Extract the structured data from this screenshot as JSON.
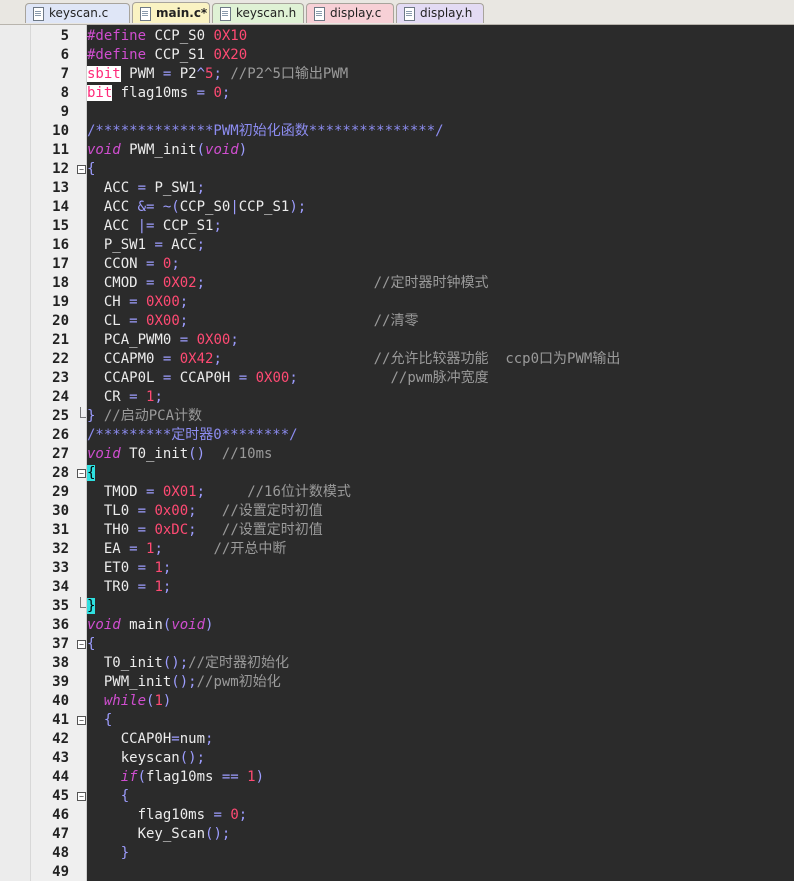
{
  "tabs": [
    {
      "label": "keyscan.c",
      "bg": "#dfe6f7",
      "width": 105,
      "active": false
    },
    {
      "label": "main.c*",
      "bg": "#faf3c3",
      "width": 78,
      "active": true
    },
    {
      "label": "keyscan.h",
      "bg": "#dff2d5",
      "width": 92,
      "active": false
    },
    {
      "label": "display.c",
      "bg": "#f7d0d6",
      "width": 88,
      "active": false
    },
    {
      "label": "display.h",
      "bg": "#e3dbf4",
      "width": 88,
      "active": false
    }
  ],
  "lines": [
    {
      "n": 5,
      "fold": "",
      "code": [
        [
          "pp",
          "#define"
        ],
        [
          "t",
          " CCP_S0 "
        ],
        [
          "num",
          "0X10"
        ]
      ]
    },
    {
      "n": 6,
      "fold": "",
      "code": [
        [
          "pp",
          "#define"
        ],
        [
          "t",
          " CCP_S1 "
        ],
        [
          "num",
          "0X20"
        ]
      ]
    },
    {
      "n": 7,
      "fold": "",
      "code": [
        [
          "hl",
          "sbit"
        ],
        [
          "t",
          " PWM "
        ],
        [
          "op",
          "="
        ],
        [
          "t",
          " P2"
        ],
        [
          "op",
          "^"
        ],
        [
          "num",
          "5"
        ],
        [
          "op",
          ";"
        ],
        [
          "cm",
          " //P2^5口输出PWM"
        ]
      ]
    },
    {
      "n": 8,
      "fold": "",
      "code": [
        [
          "hl",
          "bit"
        ],
        [
          "t",
          " flag10ms "
        ],
        [
          "op",
          "="
        ],
        [
          "t",
          " "
        ],
        [
          "num",
          "0"
        ],
        [
          "op",
          ";"
        ]
      ]
    },
    {
      "n": 9,
      "fold": "",
      "code": []
    },
    {
      "n": 10,
      "fold": "",
      "code": [
        [
          "cmb",
          "/**************PWM初始化函数***************/"
        ]
      ]
    },
    {
      "n": 11,
      "fold": "",
      "code": [
        [
          "kw",
          "void"
        ],
        [
          "t",
          " PWM_init"
        ],
        [
          "op",
          "("
        ],
        [
          "kw",
          "void"
        ],
        [
          "op",
          ")"
        ]
      ]
    },
    {
      "n": 12,
      "fold": "-",
      "code": [
        [
          "op",
          "{"
        ]
      ]
    },
    {
      "n": 13,
      "fold": "",
      "code": [
        [
          "t",
          "  ACC "
        ],
        [
          "op",
          "="
        ],
        [
          "t",
          " P_SW1"
        ],
        [
          "op",
          ";"
        ]
      ]
    },
    {
      "n": 14,
      "fold": "",
      "code": [
        [
          "t",
          "  ACC "
        ],
        [
          "op",
          "&= ~("
        ],
        [
          "t",
          "CCP_S0"
        ],
        [
          "op",
          "|"
        ],
        [
          "t",
          "CCP_S1"
        ],
        [
          "op",
          ");"
        ]
      ]
    },
    {
      "n": 15,
      "fold": "",
      "code": [
        [
          "t",
          "  ACC "
        ],
        [
          "op",
          "|="
        ],
        [
          "t",
          " CCP_S1"
        ],
        [
          "op",
          ";"
        ]
      ]
    },
    {
      "n": 16,
      "fold": "",
      "code": [
        [
          "t",
          "  P_SW1 "
        ],
        [
          "op",
          "="
        ],
        [
          "t",
          " ACC"
        ],
        [
          "op",
          ";"
        ]
      ]
    },
    {
      "n": 17,
      "fold": "",
      "code": [
        [
          "t",
          "  CCON "
        ],
        [
          "op",
          "="
        ],
        [
          "t",
          " "
        ],
        [
          "num",
          "0"
        ],
        [
          "op",
          ";"
        ]
      ]
    },
    {
      "n": 18,
      "fold": "",
      "code": [
        [
          "t",
          "  CMOD "
        ],
        [
          "op",
          "="
        ],
        [
          "t",
          " "
        ],
        [
          "num",
          "0X02"
        ],
        [
          "op",
          ";"
        ],
        [
          "t",
          "                    "
        ],
        [
          "cm",
          "//定时器时钟模式"
        ]
      ]
    },
    {
      "n": 19,
      "fold": "",
      "code": [
        [
          "t",
          "  CH "
        ],
        [
          "op",
          "="
        ],
        [
          "t",
          " "
        ],
        [
          "num",
          "0X00"
        ],
        [
          "op",
          ";"
        ]
      ]
    },
    {
      "n": 20,
      "fold": "",
      "code": [
        [
          "t",
          "  CL "
        ],
        [
          "op",
          "="
        ],
        [
          "t",
          " "
        ],
        [
          "num",
          "0X00"
        ],
        [
          "op",
          ";"
        ],
        [
          "t",
          "                      "
        ],
        [
          "cm",
          "//清零"
        ]
      ]
    },
    {
      "n": 21,
      "fold": "",
      "code": [
        [
          "t",
          "  PCA_PWM0 "
        ],
        [
          "op",
          "="
        ],
        [
          "t",
          " "
        ],
        [
          "num",
          "0X00"
        ],
        [
          "op",
          ";"
        ]
      ]
    },
    {
      "n": 22,
      "fold": "",
      "code": [
        [
          "t",
          "  CCAPM0 "
        ],
        [
          "op",
          "="
        ],
        [
          "t",
          " "
        ],
        [
          "num",
          "0X42"
        ],
        [
          "op",
          ";"
        ],
        [
          "t",
          "                  "
        ],
        [
          "cm",
          "//允许比较器功能  ccp0口为PWM输出"
        ]
      ]
    },
    {
      "n": 23,
      "fold": "",
      "code": [
        [
          "t",
          "  CCAP0L "
        ],
        [
          "op",
          "="
        ],
        [
          "t",
          " CCAP0H "
        ],
        [
          "op",
          "="
        ],
        [
          "t",
          " "
        ],
        [
          "num",
          "0X00"
        ],
        [
          "op",
          ";"
        ],
        [
          "t",
          "           "
        ],
        [
          "cm",
          "//pwm脉冲宽度"
        ]
      ]
    },
    {
      "n": 24,
      "fold": "",
      "code": [
        [
          "t",
          "  CR "
        ],
        [
          "op",
          "="
        ],
        [
          "t",
          " "
        ],
        [
          "num",
          "1"
        ],
        [
          "op",
          ";"
        ]
      ]
    },
    {
      "n": 25,
      "fold": "end",
      "code": [
        [
          "op",
          "}"
        ],
        [
          "cm",
          " //启动PCA计数"
        ]
      ]
    },
    {
      "n": 26,
      "fold": "",
      "code": [
        [
          "cmb",
          "/*********定时器0********/"
        ]
      ]
    },
    {
      "n": 27,
      "fold": "",
      "code": [
        [
          "kw",
          "void"
        ],
        [
          "t",
          " T0_init"
        ],
        [
          "op",
          "()"
        ],
        [
          "cm",
          "  //10ms"
        ]
      ]
    },
    {
      "n": 28,
      "fold": "-",
      "code": [
        [
          "br",
          "{"
        ]
      ]
    },
    {
      "n": 29,
      "fold": "",
      "code": [
        [
          "t",
          "  TMOD "
        ],
        [
          "op",
          "="
        ],
        [
          "t",
          " "
        ],
        [
          "num",
          "0X01"
        ],
        [
          "op",
          ";"
        ],
        [
          "t",
          "     "
        ],
        [
          "cm",
          "//16位计数模式"
        ]
      ]
    },
    {
      "n": 30,
      "fold": "",
      "code": [
        [
          "t",
          "  TL0 "
        ],
        [
          "op",
          "="
        ],
        [
          "t",
          " "
        ],
        [
          "num",
          "0x00"
        ],
        [
          "op",
          ";"
        ],
        [
          "t",
          "   "
        ],
        [
          "cm",
          "//设置定时初值"
        ]
      ]
    },
    {
      "n": 31,
      "fold": "",
      "code": [
        [
          "t",
          "  TH0 "
        ],
        [
          "op",
          "="
        ],
        [
          "t",
          " "
        ],
        [
          "num",
          "0xDC"
        ],
        [
          "op",
          ";"
        ],
        [
          "t",
          "   "
        ],
        [
          "cm",
          "//设置定时初值"
        ]
      ]
    },
    {
      "n": 32,
      "fold": "",
      "code": [
        [
          "t",
          "  EA "
        ],
        [
          "op",
          "="
        ],
        [
          "t",
          " "
        ],
        [
          "num",
          "1"
        ],
        [
          "op",
          ";"
        ],
        [
          "t",
          "      "
        ],
        [
          "cm",
          "//开总中断"
        ]
      ]
    },
    {
      "n": 33,
      "fold": "",
      "code": [
        [
          "t",
          "  ET0 "
        ],
        [
          "op",
          "="
        ],
        [
          "t",
          " "
        ],
        [
          "num",
          "1"
        ],
        [
          "op",
          ";"
        ]
      ]
    },
    {
      "n": 34,
      "fold": "",
      "code": [
        [
          "t",
          "  TR0 "
        ],
        [
          "op",
          "="
        ],
        [
          "t",
          " "
        ],
        [
          "num",
          "1"
        ],
        [
          "op",
          ";"
        ]
      ]
    },
    {
      "n": 35,
      "fold": "end",
      "code": [
        [
          "br",
          "}"
        ]
      ]
    },
    {
      "n": 36,
      "fold": "",
      "code": [
        [
          "kw",
          "void"
        ],
        [
          "t",
          " main"
        ],
        [
          "op",
          "("
        ],
        [
          "kw",
          "void"
        ],
        [
          "op",
          ")"
        ]
      ]
    },
    {
      "n": 37,
      "fold": "-",
      "code": [
        [
          "op",
          "{"
        ]
      ]
    },
    {
      "n": 38,
      "fold": "",
      "code": [
        [
          "t",
          "  T0_init"
        ],
        [
          "op",
          "();"
        ],
        [
          "cm",
          "//定时器初始化"
        ]
      ]
    },
    {
      "n": 39,
      "fold": "",
      "code": [
        [
          "t",
          "  PWM_init"
        ],
        [
          "op",
          "();"
        ],
        [
          "cm",
          "//pwm初始化"
        ]
      ]
    },
    {
      "n": 40,
      "fold": "",
      "code": [
        [
          "t",
          "  "
        ],
        [
          "kw",
          "while"
        ],
        [
          "op",
          "("
        ],
        [
          "num",
          "1"
        ],
        [
          "op",
          ")"
        ]
      ]
    },
    {
      "n": 41,
      "fold": "-",
      "code": [
        [
          "t",
          "  "
        ],
        [
          "op",
          "{"
        ]
      ]
    },
    {
      "n": 42,
      "fold": "",
      "code": [
        [
          "t",
          "    CCAP0H"
        ],
        [
          "op",
          "="
        ],
        [
          "t",
          "num"
        ],
        [
          "op",
          ";"
        ]
      ]
    },
    {
      "n": 43,
      "fold": "",
      "code": [
        [
          "t",
          "    keyscan"
        ],
        [
          "op",
          "();"
        ]
      ]
    },
    {
      "n": 44,
      "fold": "",
      "code": [
        [
          "t",
          "    "
        ],
        [
          "kw",
          "if"
        ],
        [
          "op",
          "("
        ],
        [
          "t",
          "flag10ms "
        ],
        [
          "op",
          "=="
        ],
        [
          "t",
          " "
        ],
        [
          "num",
          "1"
        ],
        [
          "op",
          ")"
        ]
      ]
    },
    {
      "n": 45,
      "fold": "-",
      "code": [
        [
          "t",
          "    "
        ],
        [
          "op",
          "{"
        ]
      ]
    },
    {
      "n": 46,
      "fold": "",
      "code": [
        [
          "t",
          "      flag10ms "
        ],
        [
          "op",
          "="
        ],
        [
          "t",
          " "
        ],
        [
          "num",
          "0"
        ],
        [
          "op",
          ";"
        ]
      ]
    },
    {
      "n": 47,
      "fold": "",
      "code": [
        [
          "t",
          "      Key_Scan"
        ],
        [
          "op",
          "();"
        ]
      ]
    },
    {
      "n": 48,
      "fold": "",
      "code": [
        [
          "t",
          "    "
        ],
        [
          "op",
          "}"
        ]
      ]
    },
    {
      "n": 49,
      "fold": "",
      "code": []
    }
  ]
}
